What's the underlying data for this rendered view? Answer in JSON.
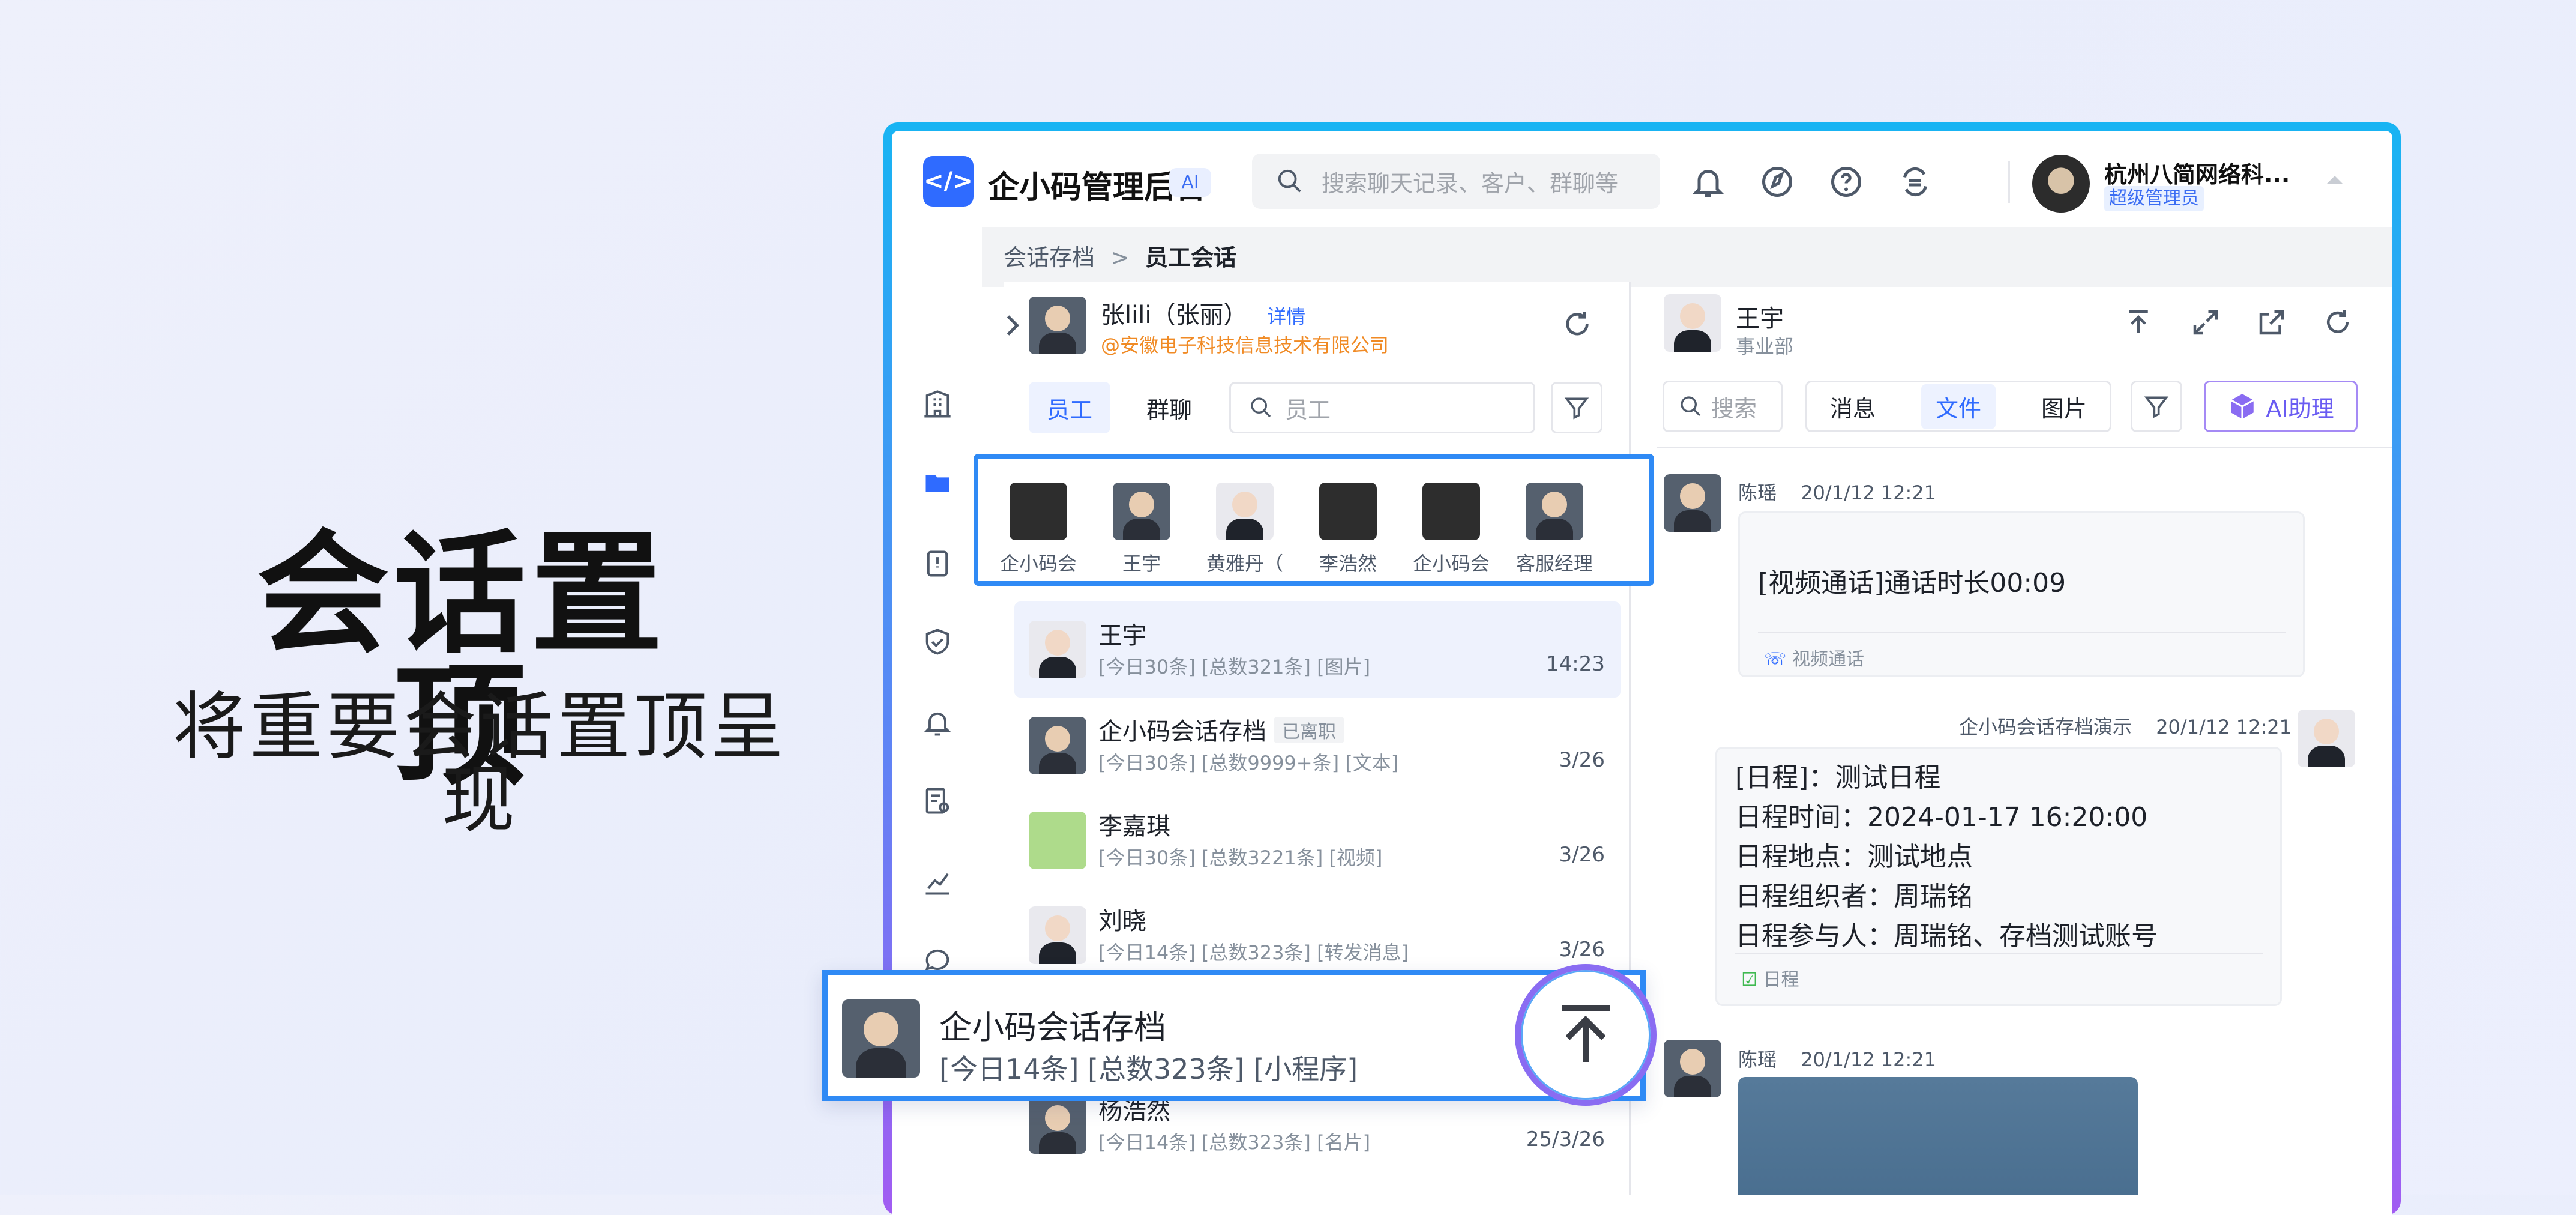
{
  "hero": {
    "title": "会话置顶",
    "subtitle": "将重要会话置顶呈现"
  },
  "header": {
    "logo_glyph": "</>",
    "app_name": "企小码管理后台",
    "ai_tag": "AI",
    "search_placeholder": "搜索聊天记录、客户、群聊等",
    "org_name": "杭州八简网络科...",
    "org_role": "超级管理员"
  },
  "breadcrumb": {
    "parent": "会话存档",
    "separator": ">",
    "current": "员工会话"
  },
  "employee": {
    "name": "张lili（张丽）",
    "detail_link": "详情",
    "company": "@安徽电子科技信息技术有限公司"
  },
  "list_tabs": {
    "employee": "员工",
    "group": "群聊"
  },
  "list_search_placeholder": "员工",
  "pinned": [
    {
      "label": "企小码会",
      "avatar": "frog"
    },
    {
      "label": "王宇",
      "avatar": "male"
    },
    {
      "label": "黄雅丹（",
      "avatar": "female"
    },
    {
      "label": "李浩然",
      "avatar": "frog"
    },
    {
      "label": "企小码会",
      "avatar": "frog"
    },
    {
      "label": "客服经理",
      "avatar": "male"
    }
  ],
  "conversations": [
    {
      "name": "王宇",
      "meta": "[今日30条] [总数321条] [图片]",
      "time": "14:23",
      "badge": ""
    },
    {
      "name": "企小码会话存档",
      "meta": "[今日30条] [总数9999+条] [文本]",
      "time": "3/26",
      "badge": "已离职"
    },
    {
      "name": "李嘉琪",
      "meta": "[今日30条] [总数3221条] [视频]",
      "time": "3/26",
      "badge": ""
    },
    {
      "name": "刘晓",
      "meta": "[今日14条] [总数323条] [转发消息]",
      "time": "3/26",
      "badge": ""
    },
    {
      "name": "杨浩然",
      "meta": "[今日14条] [总数323条] [名片]",
      "time": "25/3/26",
      "badge": ""
    }
  ],
  "floating_card": {
    "name": "企小码会话存档",
    "meta": "[今日14条] [总数323条] [小程序]"
  },
  "chat": {
    "contact_name": "王宇",
    "contact_dept": "事业部",
    "search_placeholder": "搜索",
    "segments": {
      "message": "消息",
      "file": "文件",
      "image": "图片"
    },
    "ai_button": "AI助理",
    "messages": [
      {
        "sender": "陈瑶",
        "time": "20/1/12 12:21",
        "text": "[视频通话]通话时长00:09",
        "footer": "视频通话"
      },
      {
        "sender": "企小码会话存档演示",
        "time": "20/1/12 12:21",
        "lines": [
          "[日程]：测试日程",
          "日程时间：2024-01-17 16:20:00",
          "日程地点：测试地点",
          "日程组织者：周瑞铭",
          "日程参与人：周瑞铭、存档测试账号"
        ],
        "footer": "日程"
      },
      {
        "sender": "陈瑶",
        "time": "20/1/12 12:21"
      }
    ]
  },
  "colors": {
    "accent": "#2f6bff",
    "frame_top": "#18b4f3",
    "frame_bottom": "#a25cf2",
    "pin_border": "#2f8af5"
  }
}
